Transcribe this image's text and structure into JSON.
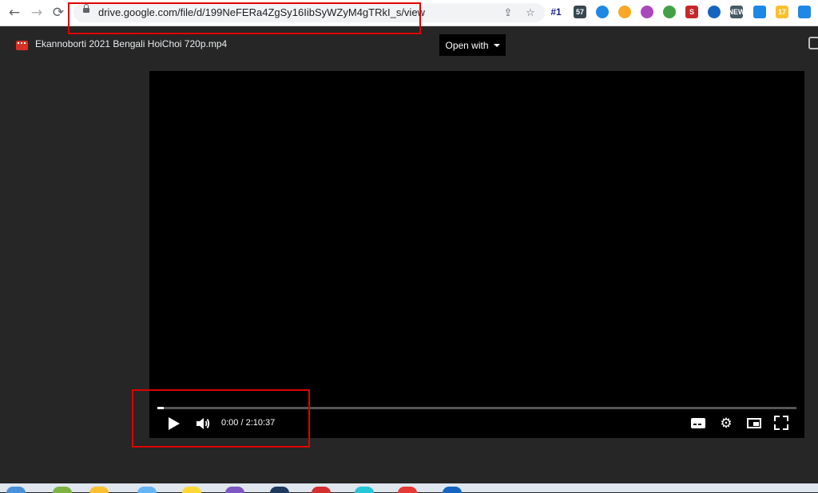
{
  "browser": {
    "url": "drive.google.com/file/d/199NeFERa4ZgSy16IibSyWZyM4gTRkI_s/view",
    "extensions": [
      {
        "label": "#1",
        "color": "#1a237e"
      },
      {
        "label": "57",
        "color": "#37474f"
      },
      {
        "label": "",
        "color": "#1e88e5"
      },
      {
        "label": "",
        "color": "#f9a825"
      },
      {
        "label": "",
        "color": "#ab47bc"
      },
      {
        "label": "",
        "color": "#43a047"
      },
      {
        "label": "S",
        "color": "#c62828"
      },
      {
        "label": "",
        "color": "#1565c0"
      },
      {
        "label": "NEW",
        "color": "#455a64"
      },
      {
        "label": "",
        "color": "#1e88e5"
      },
      {
        "label": "17",
        "color": "#fbc02d"
      },
      {
        "label": "",
        "color": "#1e88e5"
      }
    ]
  },
  "viewer": {
    "file_title": "Ekannoborti 2021 Bengali HoiChoi 720p.mp4",
    "open_with_label": "Open with"
  },
  "player": {
    "time_display": "0:00 / 2:10:37",
    "progress_fraction": 0.01
  },
  "colors": {
    "highlight_box": "#e00000",
    "viewer_bg": "#262626",
    "video_bg": "#000000"
  }
}
